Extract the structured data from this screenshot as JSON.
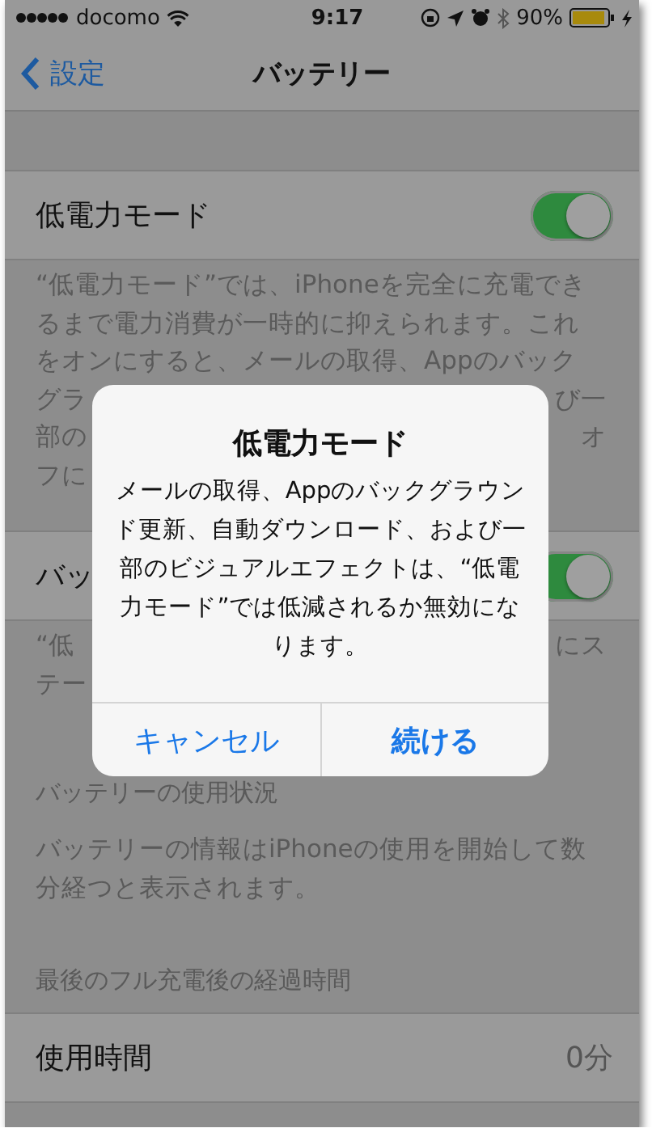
{
  "status_bar": {
    "carrier": "docomo",
    "time": "9:17",
    "battery_percent": "90%"
  },
  "nav": {
    "back": "設定",
    "title": "バッテリー"
  },
  "sections": [
    {
      "kind": "switch",
      "label": "低電力モード",
      "on": true,
      "footer": [
        {
          "left": "“低電力モード”では、iPhoneを完全に充電でき"
        },
        {
          "left": "るまで電力消費が一時的に抑えられます。これ"
        },
        {
          "left": "をオンにすると、メールの取得、Appのバック"
        },
        {
          "left": "グラ",
          "right": "び一"
        },
        {
          "left": "部の",
          "right": "オ"
        },
        {
          "left": "フに"
        }
      ]
    },
    {
      "kind": "switch",
      "label": "バッ",
      "on": true,
      "footer": [
        {
          "left": "“低",
          "right": "にス"
        },
        {
          "left": "テー"
        }
      ]
    },
    {
      "kind": "header",
      "label": "バッテリーの使用状況",
      "footer": [
        {
          "left": "バッテリーの情報はiPhoneの使用を開始して数"
        },
        {
          "left": "分経つと表示されます。"
        }
      ]
    },
    {
      "kind": "value",
      "header": "最後のフル充電後の経過時間",
      "label": "使用時間",
      "value": "0分"
    }
  ],
  "alert": {
    "title": "低電力モード",
    "message": "メールの取得、Appのバックグラウンド更新、自動ダウンロード、および一部のビジュアルエフェクトは、“低電力モード”では低減されるか無効になります。",
    "buttons": [
      {
        "label": "キャンセル",
        "kind": "cancel"
      },
      {
        "label": "続ける",
        "kind": "default"
      }
    ]
  }
}
